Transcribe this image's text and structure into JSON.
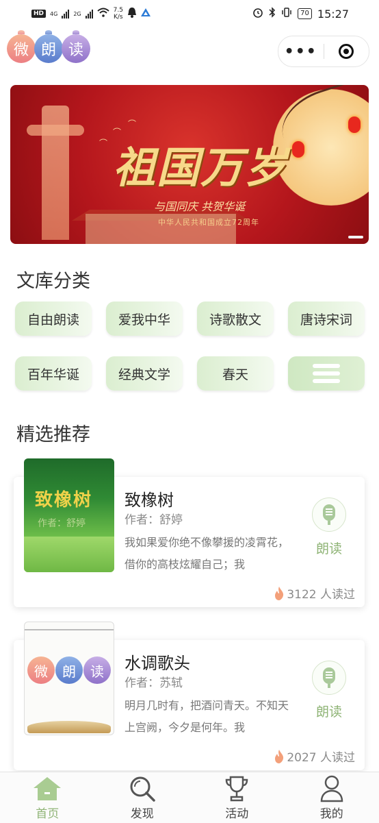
{
  "status_bar": {
    "network_badge": "HD",
    "net1": "4G",
    "net2": "2G",
    "speed_value": "7.5",
    "speed_unit": "K/s",
    "battery": "70",
    "time": "15:27"
  },
  "header": {
    "logo_chars": [
      "微",
      "朗",
      "读"
    ],
    "more_label": "•••"
  },
  "banner": {
    "title": "祖国万岁",
    "subtitle": "与国同庆 共贺华诞",
    "caption": "中华人民共和国成立72周年"
  },
  "categories": {
    "title": "文库分类",
    "items": [
      "自由朗读",
      "爱我中华",
      "诗歌散文",
      "唐诗宋词",
      "百年华诞",
      "经典文学",
      "春天"
    ]
  },
  "recommend": {
    "title": "精选推荐",
    "cards": [
      {
        "title": "致橡树",
        "author": "作者：舒婷",
        "excerpt": "我如果爱你绝不像攀援的凌霄花，借你的高枝炫耀自己；我",
        "read_label": "朗读",
        "count": "3122 人读过",
        "cover_title": "致橡树",
        "cover_sub": "作者：舒婷"
      },
      {
        "title": "水调歌头",
        "author": "作者：苏轼",
        "excerpt": "明月几时有，把酒问青天。不知天上宫阙，今夕是何年。我",
        "read_label": "朗读",
        "count": "2027 人读过",
        "cover_chars": [
          "微",
          "朗",
          "读"
        ]
      }
    ]
  },
  "bottom_nav": {
    "items": [
      {
        "label": "首页",
        "icon": "home-icon",
        "active": true
      },
      {
        "label": "发现",
        "icon": "search-icon",
        "active": false
      },
      {
        "label": "活动",
        "icon": "trophy-icon",
        "active": false
      },
      {
        "label": "我的",
        "icon": "user-icon",
        "active": false
      }
    ]
  },
  "colors": {
    "accent_green": "#8fb476",
    "banner_red": "#b4161c"
  }
}
